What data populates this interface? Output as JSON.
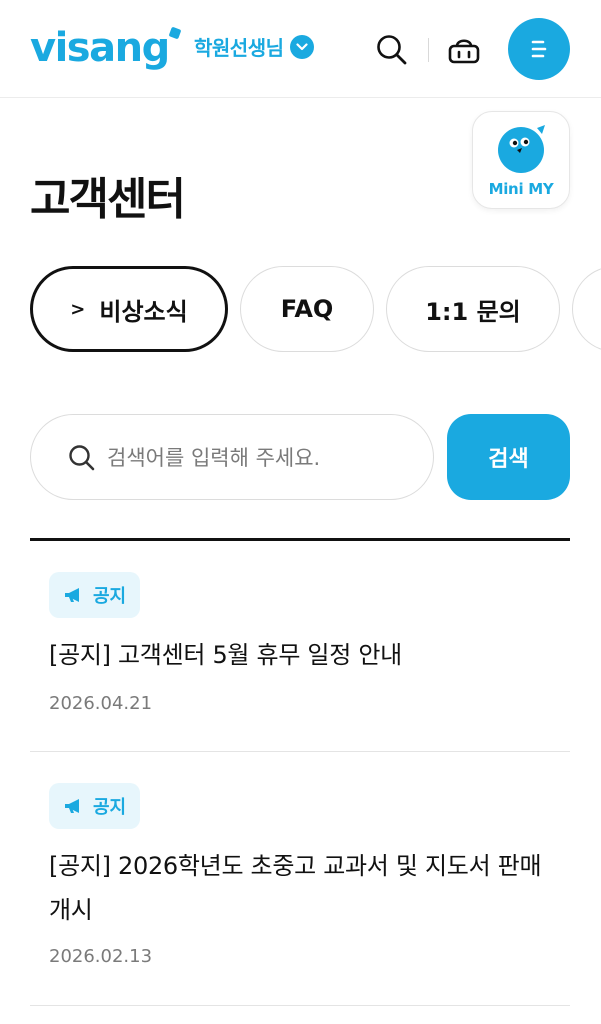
{
  "header": {
    "logo": "visang",
    "user_type": "학원선생님",
    "icons": [
      "search-icon",
      "basket-icon",
      "menu-icon",
      "chevron-down-icon"
    ],
    "accent_color": "#1aa9e0"
  },
  "mini_my": {
    "label": "Mini MY"
  },
  "page": {
    "title": "고객센터"
  },
  "tabs": [
    {
      "label": "비상소식",
      "active": true
    },
    {
      "label": "FAQ",
      "active": false
    },
    {
      "label": "1:1 문의",
      "active": false
    },
    {
      "label": "",
      "active": false
    }
  ],
  "search": {
    "placeholder": "검색어를 입력해 주세요.",
    "value": "",
    "button_label": "검색"
  },
  "notices": [
    {
      "badge": "공지",
      "title": "[공지]  고객센터 5월 휴무 일정 안내",
      "date": "2026.04.21"
    },
    {
      "badge": "공지",
      "title": "[공지]  2026학년도 초중고 교과서 및 지도서 판매 개시",
      "date": "2026.02.13"
    }
  ]
}
